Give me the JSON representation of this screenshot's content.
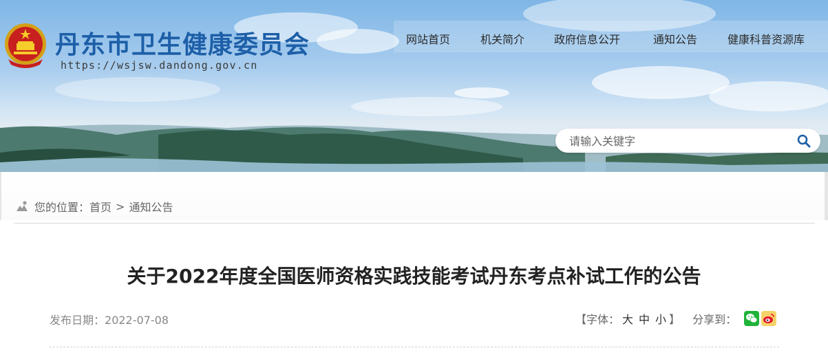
{
  "site": {
    "title": "丹东市卫生健康委员会",
    "url": "https://wsjsw.dandong.gov.cn"
  },
  "nav": {
    "items": [
      {
        "label": "网站首页"
      },
      {
        "label": "机关简介"
      },
      {
        "label": "政府信息公开"
      },
      {
        "label": "通知公告"
      },
      {
        "label": "健康科普资源库"
      }
    ]
  },
  "search": {
    "placeholder": "请输入关键字",
    "icon": "search-icon"
  },
  "breadcrumb": {
    "prefix": "您的位置：",
    "home": "首页",
    "separator": ">",
    "current": "通知公告",
    "icon": "location-icon"
  },
  "article": {
    "title": "关于2022年度全国医师资格实践技能考试丹东考点补试工作的公告",
    "date_label": "发布日期：",
    "date": "2022-07-08",
    "font_size_label_open": "【字体：",
    "font_large": "大",
    "font_medium": "中",
    "font_small": "小",
    "font_size_label_close": "】",
    "share_label": "分享到：",
    "share_icons": [
      "wechat-icon",
      "weibo-icon"
    ]
  },
  "colors": {
    "title_blue": "#1d5fa8",
    "wechat_green": "#20b33a",
    "weibo_yellow": "#f6d36a"
  }
}
